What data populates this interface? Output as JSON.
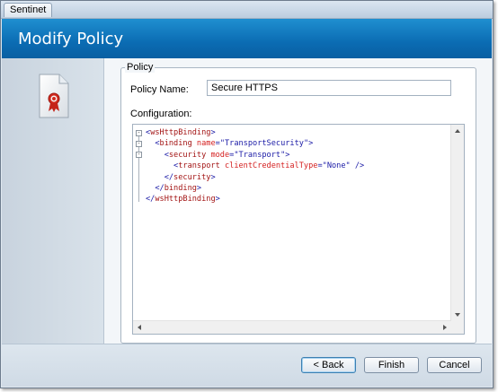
{
  "window": {
    "title": "Sentinet"
  },
  "header": {
    "title": "Modify Policy"
  },
  "left_panel": {
    "icon": "certificate-document-icon"
  },
  "policy_group": {
    "legend": "Policy",
    "name_label": "Policy Name:",
    "name_value": "Secure HTTPS",
    "configuration_label": "Configuration:"
  },
  "code_lines": [
    {
      "fold": "-",
      "parts": [
        {
          "c": "t-br",
          "t": "<"
        },
        {
          "c": "t-tag",
          "t": "wsHttpBinding"
        },
        {
          "c": "t-br",
          "t": ">"
        }
      ]
    },
    {
      "fold": "-",
      "parts": [
        {
          "c": "t-br",
          "t": "  <"
        },
        {
          "c": "t-tag",
          "t": "binding"
        },
        {
          "c": "t-attr",
          "t": " name"
        },
        {
          "c": "t-br",
          "t": "="
        },
        {
          "c": "t-val",
          "t": "\"TransportSecurity\""
        },
        {
          "c": "t-br",
          "t": ">"
        }
      ]
    },
    {
      "fold": "-",
      "parts": [
        {
          "c": "t-br",
          "t": "    <"
        },
        {
          "c": "t-tag",
          "t": "security"
        },
        {
          "c": "t-attr",
          "t": " mode"
        },
        {
          "c": "t-br",
          "t": "="
        },
        {
          "c": "t-val",
          "t": "\"Transport\""
        },
        {
          "c": "t-br",
          "t": ">"
        }
      ]
    },
    {
      "fold": "",
      "parts": [
        {
          "c": "t-br",
          "t": "      <"
        },
        {
          "c": "t-tag",
          "t": "transport"
        },
        {
          "c": "t-attr",
          "t": " clientCredentialType"
        },
        {
          "c": "t-br",
          "t": "="
        },
        {
          "c": "t-val",
          "t": "\"None\""
        },
        {
          "c": "t-br",
          "t": " />"
        }
      ]
    },
    {
      "fold": "",
      "parts": [
        {
          "c": "t-br",
          "t": "    </"
        },
        {
          "c": "t-tag",
          "t": "security"
        },
        {
          "c": "t-br",
          "t": ">"
        }
      ]
    },
    {
      "fold": "",
      "parts": [
        {
          "c": "t-br",
          "t": "  </"
        },
        {
          "c": "t-tag",
          "t": "binding"
        },
        {
          "c": "t-br",
          "t": ">"
        }
      ]
    },
    {
      "fold": "",
      "parts": [
        {
          "c": "t-br",
          "t": "</"
        },
        {
          "c": "t-tag",
          "t": "wsHttpBinding"
        },
        {
          "c": "t-br",
          "t": ">"
        }
      ]
    }
  ],
  "footer": {
    "back_label": "< Back",
    "finish_label": "Finish",
    "cancel_label": "Cancel"
  },
  "colors": {
    "header_blue": "#0b6cb3",
    "xml_tag": "#a31515",
    "xml_attr": "#d41e1e",
    "xml_value": "#1a1aa6"
  }
}
